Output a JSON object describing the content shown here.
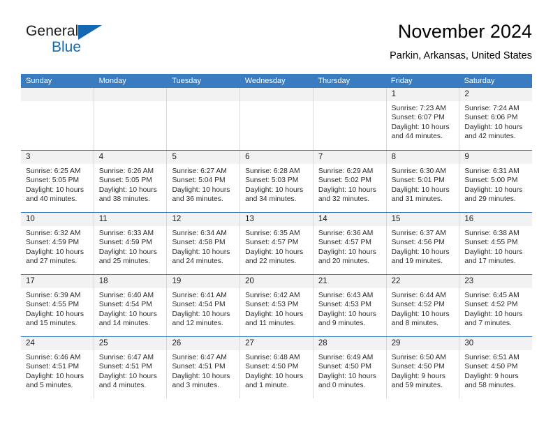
{
  "brand": {
    "name_part1": "General",
    "name_part2": "Blue"
  },
  "header": {
    "month_title": "November 2024",
    "location": "Parkin, Arkansas, United States"
  },
  "theme": {
    "header_blue": "#3a7cc0",
    "brand_blue": "#1268b3",
    "daynum_band": "#f2f2f2",
    "cell_border": "#d8d8d8"
  },
  "weekdays": [
    "Sunday",
    "Monday",
    "Tuesday",
    "Wednesday",
    "Thursday",
    "Friday",
    "Saturday"
  ],
  "weeks": [
    [
      {
        "day": "",
        "sunrise": "",
        "sunset": "",
        "daylight1": "",
        "daylight2": ""
      },
      {
        "day": "",
        "sunrise": "",
        "sunset": "",
        "daylight1": "",
        "daylight2": ""
      },
      {
        "day": "",
        "sunrise": "",
        "sunset": "",
        "daylight1": "",
        "daylight2": ""
      },
      {
        "day": "",
        "sunrise": "",
        "sunset": "",
        "daylight1": "",
        "daylight2": ""
      },
      {
        "day": "",
        "sunrise": "",
        "sunset": "",
        "daylight1": "",
        "daylight2": ""
      },
      {
        "day": "1",
        "sunrise": "Sunrise: 7:23 AM",
        "sunset": "Sunset: 6:07 PM",
        "daylight1": "Daylight: 10 hours",
        "daylight2": "and 44 minutes."
      },
      {
        "day": "2",
        "sunrise": "Sunrise: 7:24 AM",
        "sunset": "Sunset: 6:06 PM",
        "daylight1": "Daylight: 10 hours",
        "daylight2": "and 42 minutes."
      }
    ],
    [
      {
        "day": "3",
        "sunrise": "Sunrise: 6:25 AM",
        "sunset": "Sunset: 5:05 PM",
        "daylight1": "Daylight: 10 hours",
        "daylight2": "and 40 minutes."
      },
      {
        "day": "4",
        "sunrise": "Sunrise: 6:26 AM",
        "sunset": "Sunset: 5:05 PM",
        "daylight1": "Daylight: 10 hours",
        "daylight2": "and 38 minutes."
      },
      {
        "day": "5",
        "sunrise": "Sunrise: 6:27 AM",
        "sunset": "Sunset: 5:04 PM",
        "daylight1": "Daylight: 10 hours",
        "daylight2": "and 36 minutes."
      },
      {
        "day": "6",
        "sunrise": "Sunrise: 6:28 AM",
        "sunset": "Sunset: 5:03 PM",
        "daylight1": "Daylight: 10 hours",
        "daylight2": "and 34 minutes."
      },
      {
        "day": "7",
        "sunrise": "Sunrise: 6:29 AM",
        "sunset": "Sunset: 5:02 PM",
        "daylight1": "Daylight: 10 hours",
        "daylight2": "and 32 minutes."
      },
      {
        "day": "8",
        "sunrise": "Sunrise: 6:30 AM",
        "sunset": "Sunset: 5:01 PM",
        "daylight1": "Daylight: 10 hours",
        "daylight2": "and 31 minutes."
      },
      {
        "day": "9",
        "sunrise": "Sunrise: 6:31 AM",
        "sunset": "Sunset: 5:00 PM",
        "daylight1": "Daylight: 10 hours",
        "daylight2": "and 29 minutes."
      }
    ],
    [
      {
        "day": "10",
        "sunrise": "Sunrise: 6:32 AM",
        "sunset": "Sunset: 4:59 PM",
        "daylight1": "Daylight: 10 hours",
        "daylight2": "and 27 minutes."
      },
      {
        "day": "11",
        "sunrise": "Sunrise: 6:33 AM",
        "sunset": "Sunset: 4:59 PM",
        "daylight1": "Daylight: 10 hours",
        "daylight2": "and 25 minutes."
      },
      {
        "day": "12",
        "sunrise": "Sunrise: 6:34 AM",
        "sunset": "Sunset: 4:58 PM",
        "daylight1": "Daylight: 10 hours",
        "daylight2": "and 24 minutes."
      },
      {
        "day": "13",
        "sunrise": "Sunrise: 6:35 AM",
        "sunset": "Sunset: 4:57 PM",
        "daylight1": "Daylight: 10 hours",
        "daylight2": "and 22 minutes."
      },
      {
        "day": "14",
        "sunrise": "Sunrise: 6:36 AM",
        "sunset": "Sunset: 4:57 PM",
        "daylight1": "Daylight: 10 hours",
        "daylight2": "and 20 minutes."
      },
      {
        "day": "15",
        "sunrise": "Sunrise: 6:37 AM",
        "sunset": "Sunset: 4:56 PM",
        "daylight1": "Daylight: 10 hours",
        "daylight2": "and 19 minutes."
      },
      {
        "day": "16",
        "sunrise": "Sunrise: 6:38 AM",
        "sunset": "Sunset: 4:55 PM",
        "daylight1": "Daylight: 10 hours",
        "daylight2": "and 17 minutes."
      }
    ],
    [
      {
        "day": "17",
        "sunrise": "Sunrise: 6:39 AM",
        "sunset": "Sunset: 4:55 PM",
        "daylight1": "Daylight: 10 hours",
        "daylight2": "and 15 minutes."
      },
      {
        "day": "18",
        "sunrise": "Sunrise: 6:40 AM",
        "sunset": "Sunset: 4:54 PM",
        "daylight1": "Daylight: 10 hours",
        "daylight2": "and 14 minutes."
      },
      {
        "day": "19",
        "sunrise": "Sunrise: 6:41 AM",
        "sunset": "Sunset: 4:54 PM",
        "daylight1": "Daylight: 10 hours",
        "daylight2": "and 12 minutes."
      },
      {
        "day": "20",
        "sunrise": "Sunrise: 6:42 AM",
        "sunset": "Sunset: 4:53 PM",
        "daylight1": "Daylight: 10 hours",
        "daylight2": "and 11 minutes."
      },
      {
        "day": "21",
        "sunrise": "Sunrise: 6:43 AM",
        "sunset": "Sunset: 4:53 PM",
        "daylight1": "Daylight: 10 hours",
        "daylight2": "and 9 minutes."
      },
      {
        "day": "22",
        "sunrise": "Sunrise: 6:44 AM",
        "sunset": "Sunset: 4:52 PM",
        "daylight1": "Daylight: 10 hours",
        "daylight2": "and 8 minutes."
      },
      {
        "day": "23",
        "sunrise": "Sunrise: 6:45 AM",
        "sunset": "Sunset: 4:52 PM",
        "daylight1": "Daylight: 10 hours",
        "daylight2": "and 7 minutes."
      }
    ],
    [
      {
        "day": "24",
        "sunrise": "Sunrise: 6:46 AM",
        "sunset": "Sunset: 4:51 PM",
        "daylight1": "Daylight: 10 hours",
        "daylight2": "and 5 minutes."
      },
      {
        "day": "25",
        "sunrise": "Sunrise: 6:47 AM",
        "sunset": "Sunset: 4:51 PM",
        "daylight1": "Daylight: 10 hours",
        "daylight2": "and 4 minutes."
      },
      {
        "day": "26",
        "sunrise": "Sunrise: 6:47 AM",
        "sunset": "Sunset: 4:51 PM",
        "daylight1": "Daylight: 10 hours",
        "daylight2": "and 3 minutes."
      },
      {
        "day": "27",
        "sunrise": "Sunrise: 6:48 AM",
        "sunset": "Sunset: 4:50 PM",
        "daylight1": "Daylight: 10 hours",
        "daylight2": "and 1 minute."
      },
      {
        "day": "28",
        "sunrise": "Sunrise: 6:49 AM",
        "sunset": "Sunset: 4:50 PM",
        "daylight1": "Daylight: 10 hours",
        "daylight2": "and 0 minutes."
      },
      {
        "day": "29",
        "sunrise": "Sunrise: 6:50 AM",
        "sunset": "Sunset: 4:50 PM",
        "daylight1": "Daylight: 9 hours",
        "daylight2": "and 59 minutes."
      },
      {
        "day": "30",
        "sunrise": "Sunrise: 6:51 AM",
        "sunset": "Sunset: 4:50 PM",
        "daylight1": "Daylight: 9 hours",
        "daylight2": "and 58 minutes."
      }
    ]
  ]
}
